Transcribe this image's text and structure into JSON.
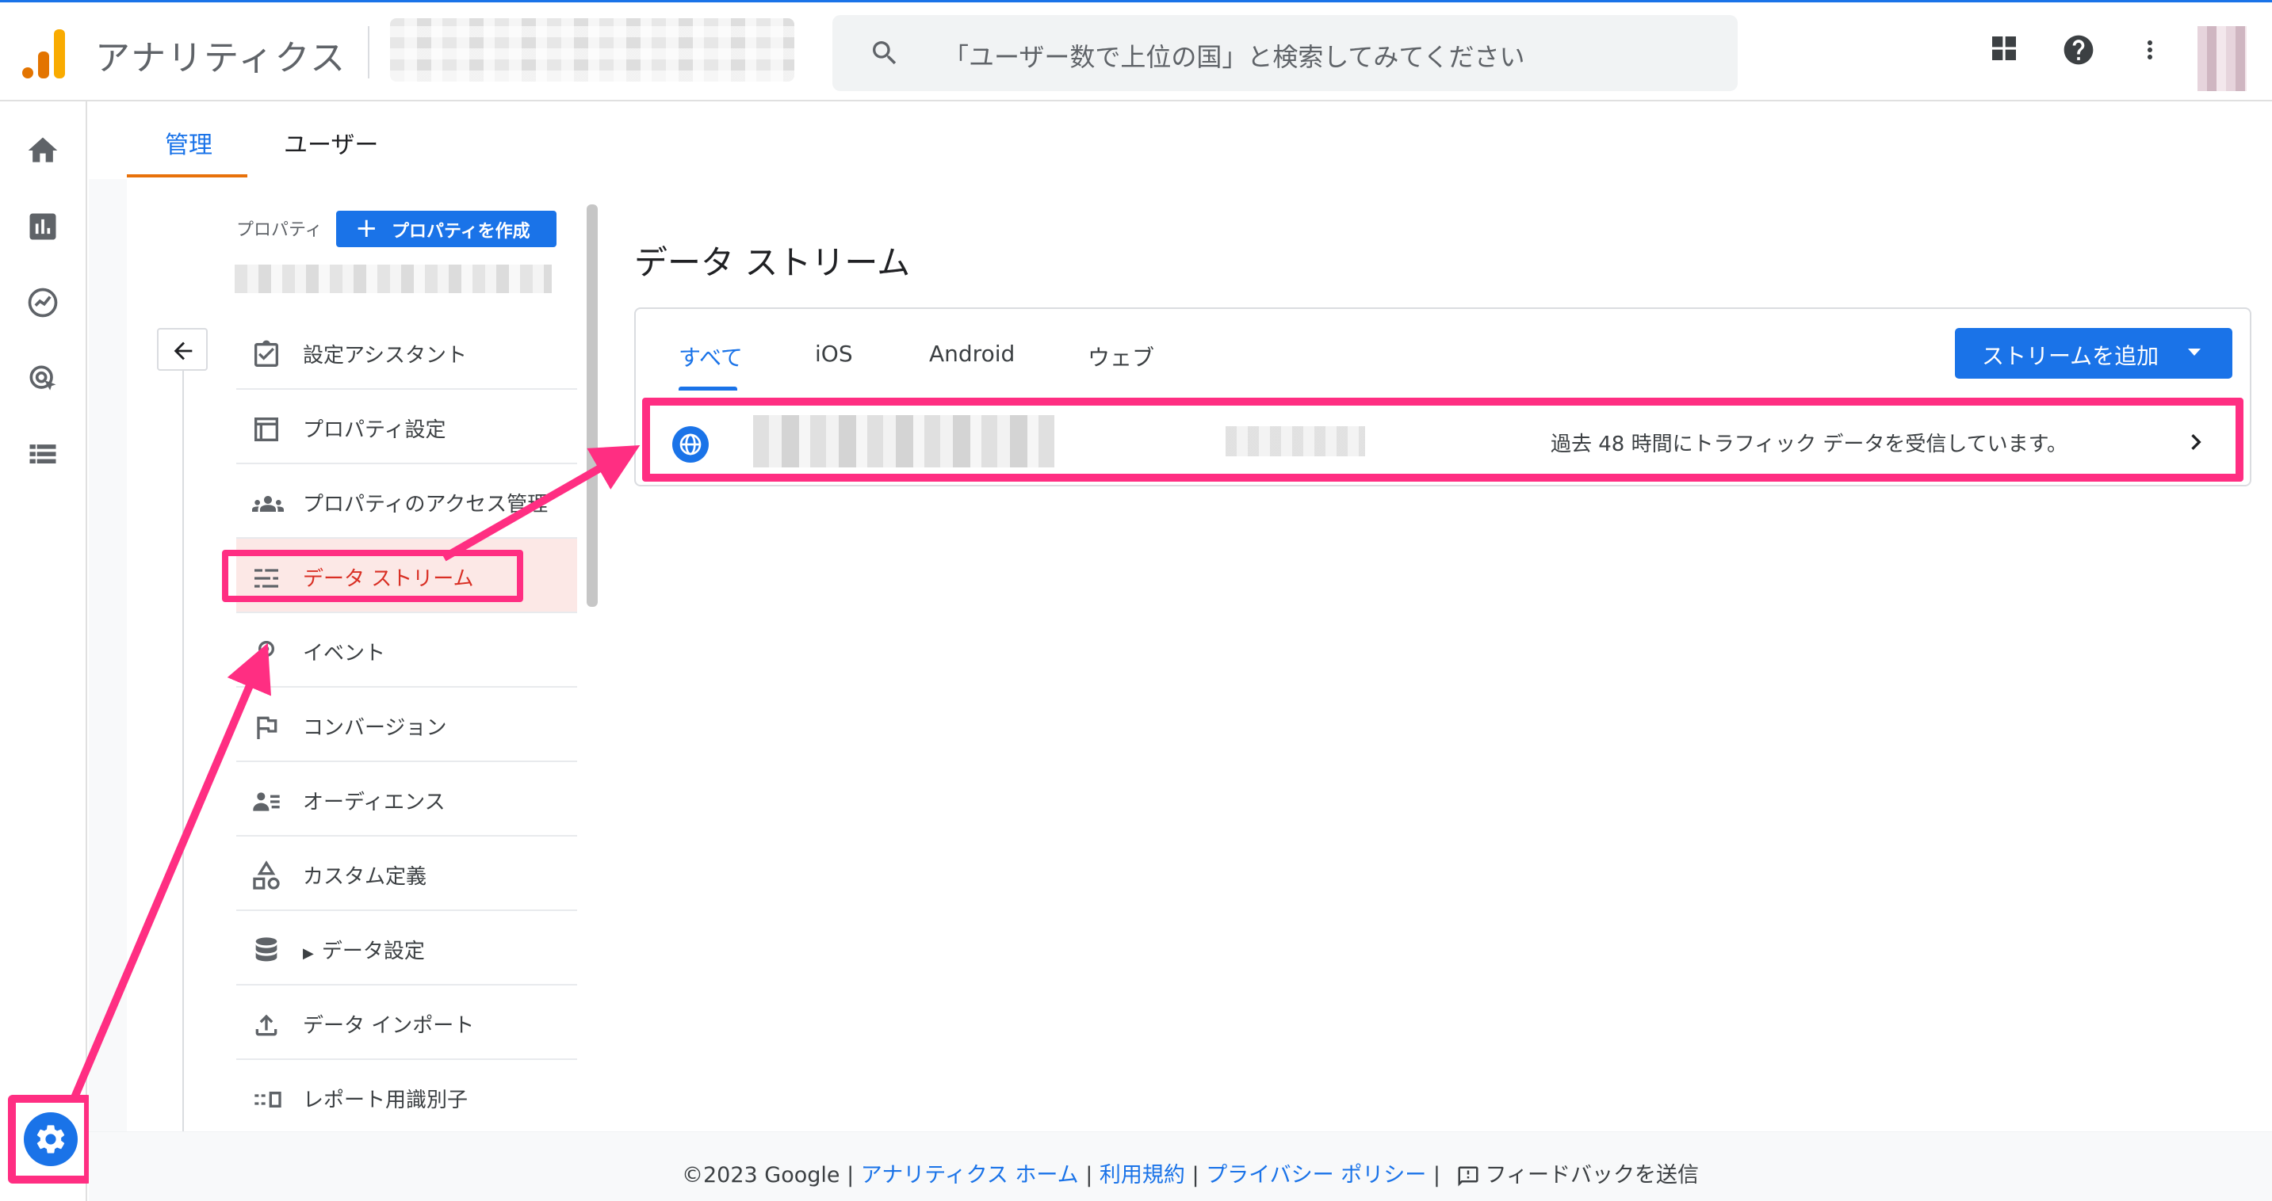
{
  "topbar": {
    "app_title": "アナリティクス",
    "search_placeholder": "「ユーザー数で上位の国」と検索してみてください",
    "logo_colors": [
      "#f9ab00",
      "#e37400"
    ]
  },
  "tabs": [
    {
      "label": "管理",
      "active": true
    },
    {
      "label": "ユーザー",
      "active": false
    }
  ],
  "property": {
    "label": "プロパティ",
    "create_label": "プロパティを作成"
  },
  "menu": [
    {
      "label": "設定アシスタント",
      "icon": "checklist-icon"
    },
    {
      "label": "プロパティ設定",
      "icon": "property-settings-icon"
    },
    {
      "label": "プロパティのアクセス管理",
      "icon": "people-icon"
    },
    {
      "label": "データ ストリーム",
      "icon": "data-streams-icon",
      "active": true
    },
    {
      "label": "イベント",
      "icon": "events-icon"
    },
    {
      "label": "コンバージョン",
      "icon": "flag-icon"
    },
    {
      "label": "オーディエンス",
      "icon": "audience-icon"
    },
    {
      "label": "カスタム定義",
      "icon": "shapes-icon"
    },
    {
      "label": "データ設定",
      "icon": "database-icon"
    },
    {
      "label": "データ インポート",
      "icon": "upload-icon"
    },
    {
      "label": "レポート用識別子",
      "icon": "identifier-icon"
    }
  ],
  "main": {
    "title": "データ ストリーム",
    "stream_tabs": [
      {
        "label": "すべて",
        "selected": true
      },
      {
        "label": "iOS"
      },
      {
        "label": "Android"
      },
      {
        "label": "ウェブ"
      }
    ],
    "add_stream_label": "ストリームを追加",
    "stream": {
      "status": "過去 48 時間にトラフィック データを受信しています。"
    }
  },
  "footer": {
    "copyright": "©2023 Google |",
    "home_link": "アナリティクス ホーム",
    "sep1": "|",
    "terms_link": "利用規約",
    "sep2": "|",
    "privacy_link": "プライバシー ポリシー",
    "sep3": "|",
    "feedback_label": "フィードバックを送信"
  },
  "colors": {
    "accent": "#1a73e8",
    "highlight": "#ff2e82",
    "active_tab_underline": "#e8710a",
    "active_menu_text": "#d93025"
  }
}
